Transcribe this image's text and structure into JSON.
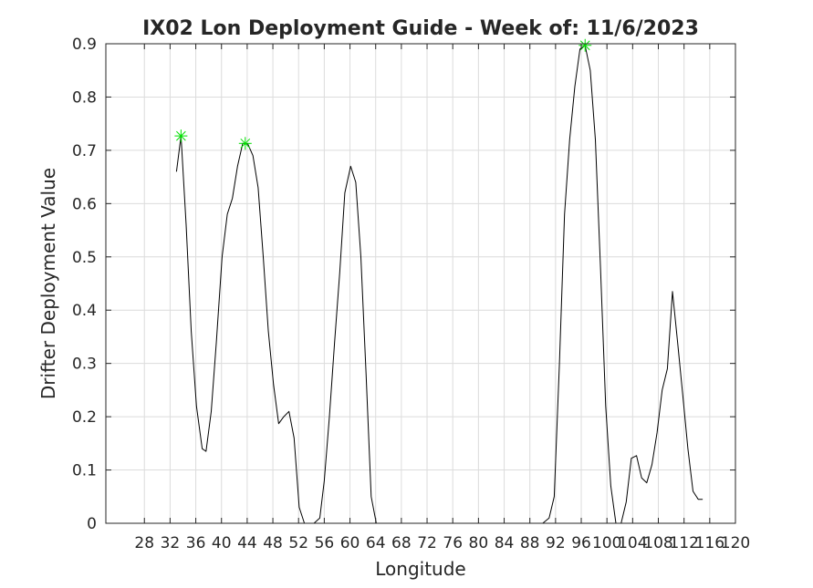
{
  "chart_data": {
    "type": "line",
    "title": "IX02 Lon Deployment Guide - Week of: 11/6/2023",
    "xlabel": "Longitude",
    "ylabel": "Drifter Deployment Value",
    "xlim": [
      22,
      120
    ],
    "ylim": [
      0,
      0.9
    ],
    "xticks": [
      28,
      32,
      36,
      40,
      44,
      48,
      52,
      56,
      60,
      64,
      68,
      72,
      76,
      80,
      84,
      88,
      92,
      96,
      100,
      104,
      108,
      112,
      116,
      120
    ],
    "yticks": [
      0,
      0.1,
      0.2,
      0.3,
      0.4,
      0.5,
      0.6,
      0.7,
      0.8,
      0.9
    ],
    "ytick_labels": [
      "0",
      "0.1",
      "0.2",
      "0.3",
      "0.4",
      "0.5",
      "0.6",
      "0.7",
      "0.8",
      "0.9"
    ],
    "grid": true,
    "series": [
      {
        "color": "#000000",
        "x": [
          33.0,
          33.7,
          34.5,
          35.3,
          36.1,
          37.0,
          37.6,
          38.4,
          39.2,
          40.1,
          40.9,
          41.7,
          42.5,
          43.3,
          44.1,
          44.9,
          45.7,
          46.5,
          47.3,
          48.1,
          48.9,
          49.7,
          50.5,
          51.3,
          52.1,
          52.9,
          53.6,
          54.4,
          55.3,
          56.0,
          56.8,
          57.6,
          58.4,
          59.2,
          60.1,
          60.9,
          61.7,
          62.5,
          63.3,
          64.1,
          64.9,
          65.3,
          70.0,
          80.0,
          90.0,
          91.0,
          91.8,
          92.6,
          93.4,
          94.2,
          95.0,
          95.8,
          96.6,
          97.4,
          98.2,
          99.0,
          99.8,
          100.6,
          101.4,
          102.2,
          103.0,
          103.8,
          104.6,
          105.4,
          106.2,
          107.0,
          107.8,
          108.6,
          109.4,
          110.2,
          111.0,
          111.8,
          112.6,
          113.4,
          114.2,
          114.9
        ],
        "y": [
          0.66,
          0.727,
          0.56,
          0.36,
          0.22,
          0.14,
          0.135,
          0.21,
          0.34,
          0.5,
          0.58,
          0.61,
          0.67,
          0.713,
          0.712,
          0.69,
          0.63,
          0.5,
          0.36,
          0.26,
          0.187,
          0.2,
          0.21,
          0.16,
          0.03,
          0.0,
          0.0,
          0.0,
          0.01,
          0.08,
          0.2,
          0.34,
          0.47,
          0.62,
          0.67,
          0.64,
          0.5,
          0.28,
          0.05,
          0.0,
          0.0,
          0.0,
          0.0,
          0.0,
          0.0,
          0.01,
          0.05,
          0.3,
          0.58,
          0.72,
          0.82,
          0.89,
          0.897,
          0.85,
          0.72,
          0.48,
          0.22,
          0.07,
          0.0,
          0.0,
          0.04,
          0.122,
          0.127,
          0.085,
          0.076,
          0.11,
          0.17,
          0.25,
          0.29,
          0.435,
          0.34,
          0.24,
          0.14,
          0.06,
          0.045,
          0.045
        ]
      }
    ],
    "markers": {
      "color": "#00e000",
      "points": [
        {
          "x": 33.7,
          "y": 0.727
        },
        {
          "x": 43.7,
          "y": 0.713
        },
        {
          "x": 96.6,
          "y": 0.897
        }
      ]
    }
  }
}
